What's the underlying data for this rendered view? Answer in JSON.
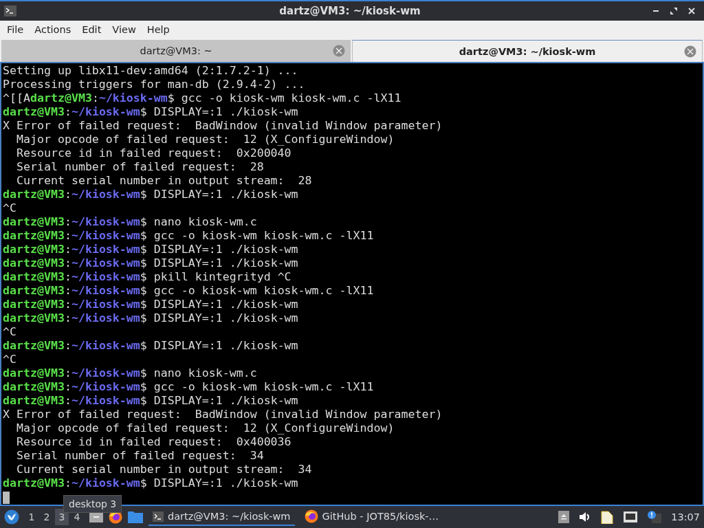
{
  "window": {
    "title": "dartz@VM3: ~/kiosk-wm"
  },
  "menu": [
    "File",
    "Actions",
    "Edit",
    "View",
    "Help"
  ],
  "tabs": [
    {
      "label": "dartz@VM3: ~",
      "selected": false
    },
    {
      "label": "dartz@VM3: ~/kiosk-wm",
      "selected": true
    }
  ],
  "terminal": {
    "lines": [
      {
        "kind": "output",
        "text": "Setting up libx11-dev:amd64 (2:1.7.2-1) ..."
      },
      {
        "kind": "output",
        "text": "Processing triggers for man-db (2.9.4-2) ..."
      },
      {
        "kind": "prompt",
        "prefix": "^[[A",
        "user": "dartz@VM3",
        "separator": ":",
        "path": "~/kiosk-wm",
        "command": "$ gcc -o kiosk-wm kiosk-wm.c -lX11"
      },
      {
        "kind": "prompt",
        "user": "dartz@VM3",
        "separator": ":",
        "path": "~/kiosk-wm",
        "command": "$ DISPLAY=:1 ./kiosk-wm"
      },
      {
        "kind": "output",
        "text": "X Error of failed request:  BadWindow (invalid Window parameter)"
      },
      {
        "kind": "output",
        "text": "  Major opcode of failed request:  12 (X_ConfigureWindow)"
      },
      {
        "kind": "output",
        "text": "  Resource id in failed request:  0x200040"
      },
      {
        "kind": "output",
        "text": "  Serial number of failed request:  28"
      },
      {
        "kind": "output",
        "text": "  Current serial number in output stream:  28"
      },
      {
        "kind": "prompt",
        "user": "dartz@VM3",
        "separator": ":",
        "path": "~/kiosk-wm",
        "command": "$ DISPLAY=:1 ./kiosk-wm"
      },
      {
        "kind": "output",
        "text": "^C"
      },
      {
        "kind": "prompt",
        "user": "dartz@VM3",
        "separator": ":",
        "path": "~/kiosk-wm",
        "command": "$ nano kiosk-wm.c"
      },
      {
        "kind": "prompt",
        "user": "dartz@VM3",
        "separator": ":",
        "path": "~/kiosk-wm",
        "command": "$ gcc -o kiosk-wm kiosk-wm.c -lX11"
      },
      {
        "kind": "prompt",
        "user": "dartz@VM3",
        "separator": ":",
        "path": "~/kiosk-wm",
        "command": "$ DISPLAY=:1 ./kiosk-wm"
      },
      {
        "kind": "prompt",
        "user": "dartz@VM3",
        "separator": ":",
        "path": "~/kiosk-wm",
        "command": "$ DISPLAY=:1 ./kiosk-wm"
      },
      {
        "kind": "prompt",
        "user": "dartz@VM3",
        "separator": ":",
        "path": "~/kiosk-wm",
        "command": "$ pkill kintegrityd ^C"
      },
      {
        "kind": "prompt",
        "user": "dartz@VM3",
        "separator": ":",
        "path": "~/kiosk-wm",
        "command": "$ gcc -o kiosk-wm kiosk-wm.c -lX11"
      },
      {
        "kind": "prompt",
        "user": "dartz@VM3",
        "separator": ":",
        "path": "~/kiosk-wm",
        "command": "$ DISPLAY=:1 ./kiosk-wm"
      },
      {
        "kind": "prompt",
        "user": "dartz@VM3",
        "separator": ":",
        "path": "~/kiosk-wm",
        "command": "$ DISPLAY=:1 ./kiosk-wm"
      },
      {
        "kind": "output",
        "text": "^C"
      },
      {
        "kind": "prompt",
        "user": "dartz@VM3",
        "separator": ":",
        "path": "~/kiosk-wm",
        "command": "$ DISPLAY=:1 ./kiosk-wm"
      },
      {
        "kind": "output",
        "text": "^C"
      },
      {
        "kind": "prompt",
        "user": "dartz@VM3",
        "separator": ":",
        "path": "~/kiosk-wm",
        "command": "$ nano kiosk-wm.c"
      },
      {
        "kind": "prompt",
        "user": "dartz@VM3",
        "separator": ":",
        "path": "~/kiosk-wm",
        "command": "$ gcc -o kiosk-wm kiosk-wm.c -lX11"
      },
      {
        "kind": "prompt",
        "user": "dartz@VM3",
        "separator": ":",
        "path": "~/kiosk-wm",
        "command": "$ DISPLAY=:1 ./kiosk-wm"
      },
      {
        "kind": "output",
        "text": "X Error of failed request:  BadWindow (invalid Window parameter)"
      },
      {
        "kind": "output",
        "text": "  Major opcode of failed request:  12 (X_ConfigureWindow)"
      },
      {
        "kind": "output",
        "text": "  Resource id in failed request:  0x400036"
      },
      {
        "kind": "output",
        "text": "  Serial number of failed request:  34"
      },
      {
        "kind": "output",
        "text": "  Current serial number in output stream:  34"
      },
      {
        "kind": "prompt",
        "user": "dartz@VM3",
        "separator": ":",
        "path": "~/kiosk-wm",
        "command": "$ DISPLAY=:1 ./kiosk-wm"
      },
      {
        "kind": "cursor"
      }
    ]
  },
  "taskbar": {
    "desktops": [
      {
        "label": "1",
        "selected": false
      },
      {
        "label": "2",
        "selected": false
      },
      {
        "label": "3",
        "selected": true
      },
      {
        "label": "4",
        "selected": false
      }
    ],
    "tooltip": "desktop 3",
    "launchers": [
      {
        "kind": "desktop"
      },
      {
        "kind": "firefox"
      },
      {
        "kind": "folder"
      }
    ],
    "tasks": [
      {
        "kind": "terminal",
        "label": "dartz@VM3: ~/kiosk-wm",
        "selected": true
      },
      {
        "kind": "firefox",
        "label": "GitHub - JOT85/kiosk-…",
        "selected": false
      }
    ],
    "clock": "13:07"
  }
}
